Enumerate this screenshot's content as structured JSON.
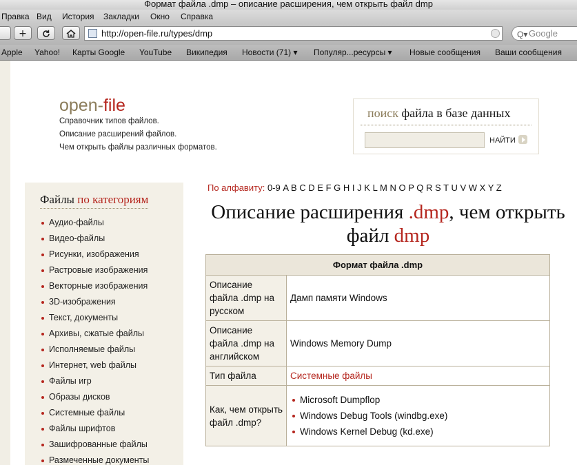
{
  "window": {
    "title": "Формат файла .dmp – описание расширения, чем открыть файл dmp"
  },
  "menu": [
    "Правка",
    "Вид",
    "История",
    "Закладки",
    "Окно",
    "Справка"
  ],
  "toolbar": {
    "add_icon": "plus-icon",
    "reload_icon": "reload-icon",
    "home_icon": "home-icon",
    "url": "http://open-file.ru/types/dmp",
    "search_placeholder": "Google"
  },
  "bookmarks": [
    "Apple",
    "Yahoo!",
    "Карты Google",
    "YouTube",
    "Википедия",
    "Новости (71) ▾",
    "Популяр...ресурсы ▾",
    "Новые сообщения",
    "Ваши сообщения"
  ],
  "site": {
    "logo_part1": "open-",
    "logo_part2": "file",
    "taglines": [
      "Справочник типов файлов.",
      "Описание расширений файлов.",
      "Чем открыть файлы различных форматов."
    ]
  },
  "search": {
    "head_soft": "поиск",
    "head_rest": " файла в базе данных",
    "button": "НАЙТИ"
  },
  "sidebar": {
    "title_part1": "Файлы ",
    "title_part2": "по категориям",
    "items": [
      "Аудио-файлы",
      "Видео-файлы",
      "Рисунки, изображения",
      "Растровые изображения",
      "Векторные изображения",
      "3D-изображения",
      "Текст, документы",
      "Архивы, сжатые файлы",
      "Исполняемые файлы",
      "Интернет, web файлы",
      "Файлы игр",
      "Образы дисков",
      "Системные файлы",
      "Файлы шрифтов",
      "Зашифрованные файлы",
      "Размеченные документы"
    ]
  },
  "alphabet": {
    "label": "По алфавиту:",
    "letters": [
      "0-9",
      "A",
      "B",
      "C",
      "D",
      "E",
      "F",
      "G",
      "H",
      "I",
      "J",
      "K",
      "L",
      "M",
      "N",
      "O",
      "P",
      "Q",
      "R",
      "S",
      "T",
      "U",
      "V",
      "W",
      "X",
      "Y",
      "Z"
    ]
  },
  "heading": {
    "part1": "Описание расширения ",
    "ext": ".dmp",
    "part2": ", чем открыть файл ",
    "name": "dmp"
  },
  "table": {
    "header": "Формат файла .dmp",
    "desc_ru_label": "Описание файла .dmp на русском",
    "desc_ru_value": "Дамп памяти Windows",
    "desc_en_label": "Описание файла .dmp на английском",
    "desc_en_value": "Windows Memory Dump",
    "type_label": "Тип файла",
    "type_value": "Системные файлы",
    "open_label": "Как, чем открыть файл .dmp?",
    "open_values": [
      "Microsoft Dumpflop",
      "Windows Debug Tools (windbg.exe)",
      "Windows Kernel Debug (kd.exe)"
    ]
  },
  "colors": {
    "accent_red": "#b5261e",
    "brand_olive": "#8b7c5a",
    "panel_beige": "#f3f0e7"
  }
}
